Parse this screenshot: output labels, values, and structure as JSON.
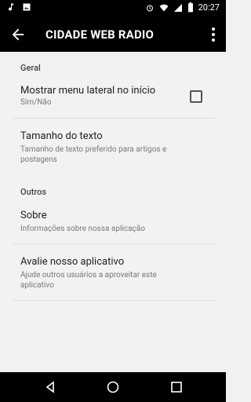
{
  "status": {
    "time": "20:27"
  },
  "appbar": {
    "title": "CIDADE WEB RADIO"
  },
  "sections": {
    "geral": "Geral",
    "outros": "Outros"
  },
  "prefs": {
    "menu_lateral": {
      "title": "Mostrar menu lateral no início",
      "summary": "Sim/Não"
    },
    "tamanho_texto": {
      "title": "Tamanho do texto",
      "summary": "Tamanho de texto preferido para artigos e postagens"
    },
    "sobre": {
      "title": "Sobre",
      "summary": "Informações sobre nossa aplicação"
    },
    "avalie": {
      "title": "Avalie nosso aplicativo",
      "summary": "Ajude outros usuários a aproveitar este aplicativo"
    }
  }
}
